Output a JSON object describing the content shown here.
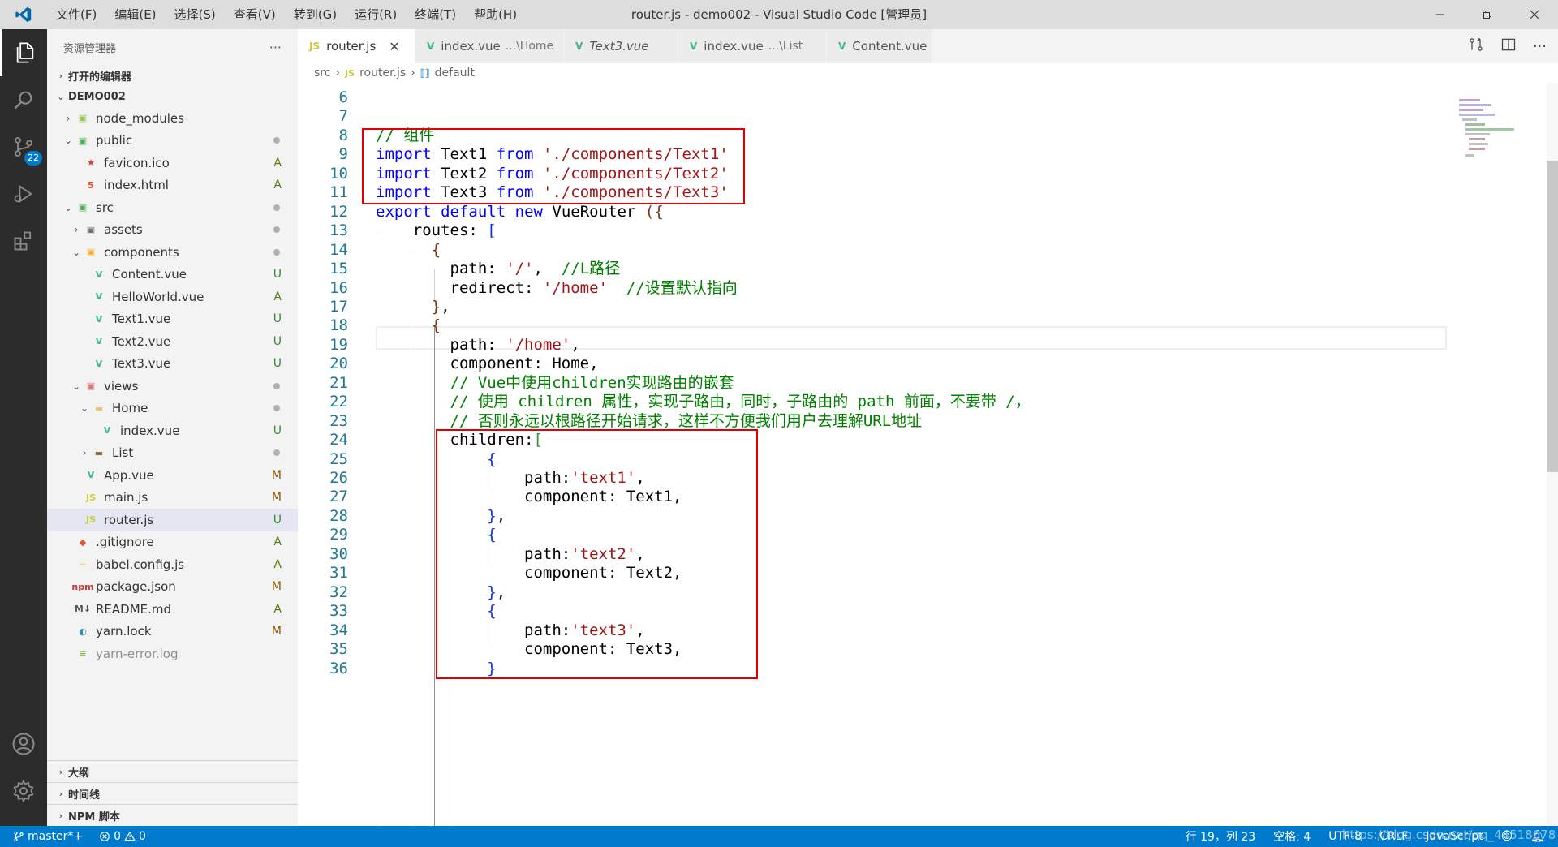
{
  "window": {
    "title": "router.js - demo002 - Visual Studio Code [管理员]",
    "menu": [
      "文件(F)",
      "编辑(E)",
      "选择(S)",
      "查看(V)",
      "转到(G)",
      "运行(R)",
      "终端(T)",
      "帮助(H)"
    ]
  },
  "activity": {
    "scm_badge": "22"
  },
  "sidebar": {
    "title": "资源管理器",
    "more": "···",
    "open_editors": "打开的编辑器",
    "project": "DEMO002",
    "tree": [
      {
        "label": "node_modules",
        "depth": 1,
        "chev": "›",
        "icon": "folder-node",
        "status": ""
      },
      {
        "label": "public",
        "depth": 1,
        "chev": "⌄",
        "icon": "folder-public",
        "status": "dot"
      },
      {
        "label": "favicon.ico",
        "depth": 2,
        "chev": "",
        "icon": "favicon",
        "status": "A"
      },
      {
        "label": "index.html",
        "depth": 2,
        "chev": "",
        "icon": "html",
        "status": "A"
      },
      {
        "label": "src",
        "depth": 1,
        "chev": "⌄",
        "icon": "folder-src",
        "status": "dot"
      },
      {
        "label": "assets",
        "depth": 2,
        "chev": "›",
        "icon": "folder-assets",
        "status": "dot"
      },
      {
        "label": "components",
        "depth": 2,
        "chev": "⌄",
        "icon": "folder-components",
        "status": "dot"
      },
      {
        "label": "Content.vue",
        "depth": 3,
        "chev": "",
        "icon": "vue",
        "status": "U"
      },
      {
        "label": "HelloWorld.vue",
        "depth": 3,
        "chev": "",
        "icon": "vue",
        "status": "A"
      },
      {
        "label": "Text1.vue",
        "depth": 3,
        "chev": "",
        "icon": "vue",
        "status": "U"
      },
      {
        "label": "Text2.vue",
        "depth": 3,
        "chev": "",
        "icon": "vue",
        "status": "U"
      },
      {
        "label": "Text3.vue",
        "depth": 3,
        "chev": "",
        "icon": "vue",
        "status": "U"
      },
      {
        "label": "views",
        "depth": 2,
        "chev": "⌄",
        "icon": "folder-views",
        "status": "dot"
      },
      {
        "label": "Home",
        "depth": 3,
        "chev": "⌄",
        "icon": "folder",
        "status": "dot"
      },
      {
        "label": "index.vue",
        "depth": 4,
        "chev": "",
        "icon": "vue",
        "status": "U"
      },
      {
        "label": "List",
        "depth": 3,
        "chev": "›",
        "icon": "folder-dark",
        "status": "dot"
      },
      {
        "label": "App.vue",
        "depth": 2,
        "chev": "",
        "icon": "vue",
        "status": "M"
      },
      {
        "label": "main.js",
        "depth": 2,
        "chev": "",
        "icon": "js",
        "status": "M"
      },
      {
        "label": "router.js",
        "depth": 2,
        "chev": "",
        "icon": "js",
        "status": "U",
        "selected": true
      },
      {
        "label": ".gitignore",
        "depth": 1,
        "chev": "",
        "icon": "git",
        "status": "A"
      },
      {
        "label": "babel.config.js",
        "depth": 1,
        "chev": "",
        "icon": "babel",
        "status": "A"
      },
      {
        "label": "package.json",
        "depth": 1,
        "chev": "",
        "icon": "npm",
        "status": "M"
      },
      {
        "label": "README.md",
        "depth": 1,
        "chev": "",
        "icon": "md",
        "status": "A"
      },
      {
        "label": "yarn.lock",
        "depth": 1,
        "chev": "",
        "icon": "yarn",
        "status": "M"
      },
      {
        "label": "yarn-error.log",
        "depth": 1,
        "chev": "",
        "icon": "log",
        "status": "",
        "muted": true
      }
    ],
    "bottom_sections": [
      "大纲",
      "时间线",
      "NPM 脚本"
    ]
  },
  "tabs": [
    {
      "label": "router.js",
      "desc": "",
      "icon": "js",
      "active": true,
      "italic": false
    },
    {
      "label": "index.vue",
      "desc": "...\\Home",
      "icon": "vue",
      "active": false,
      "italic": false
    },
    {
      "label": "Text3.vue",
      "desc": "",
      "icon": "vue",
      "active": false,
      "italic": true
    },
    {
      "label": "index.vue",
      "desc": "...\\List",
      "icon": "vue",
      "active": false,
      "italic": false
    },
    {
      "label": "Content.vue",
      "desc": "",
      "icon": "vue",
      "active": false,
      "italic": false
    }
  ],
  "breadcrumb": [
    "src",
    "router.js",
    "default"
  ],
  "code": [
    {
      "n": "6",
      "t": []
    },
    {
      "n": "7",
      "t": []
    },
    {
      "n": "8",
      "t": [
        [
          "c",
          "// 组件"
        ]
      ]
    },
    {
      "n": "9",
      "t": [
        [
          "k",
          "import"
        ],
        [
          "p",
          " Text1 "
        ],
        [
          "k",
          "from"
        ],
        [
          "p",
          " "
        ],
        [
          "s",
          "'./components/Text1'"
        ]
      ]
    },
    {
      "n": "10",
      "t": [
        [
          "k",
          "import"
        ],
        [
          "p",
          " Text2 "
        ],
        [
          "k",
          "from"
        ],
        [
          "p",
          " "
        ],
        [
          "s",
          "'./components/Text2'"
        ]
      ]
    },
    {
      "n": "11",
      "t": [
        [
          "k",
          "import"
        ],
        [
          "p",
          " Text3 "
        ],
        [
          "k",
          "from"
        ],
        [
          "p",
          " "
        ],
        [
          "s",
          "'./components/Text3'"
        ]
      ]
    },
    {
      "n": "12",
      "t": [
        [
          "k",
          "export"
        ],
        [
          "p",
          " "
        ],
        [
          "k",
          "default"
        ],
        [
          "p",
          " "
        ],
        [
          "k",
          "new"
        ],
        [
          "p",
          " VueRouter "
        ],
        [
          "b3",
          "({"
        ]
      ]
    },
    {
      "n": "13",
      "t": [
        [
          "p",
          "    routes: "
        ],
        [
          "b1",
          "["
        ]
      ]
    },
    {
      "n": "14",
      "t": [
        [
          "p",
          "      "
        ],
        [
          "b3",
          "{"
        ]
      ]
    },
    {
      "n": "15",
      "t": [
        [
          "p",
          "        path: "
        ],
        [
          "s",
          "'/'"
        ],
        [
          "p",
          ",  "
        ],
        [
          "c",
          "//L路径"
        ]
      ]
    },
    {
      "n": "16",
      "t": [
        [
          "p",
          "        redirect: "
        ],
        [
          "s",
          "'/home'"
        ],
        [
          "p",
          "  "
        ],
        [
          "c",
          "//设置默认指向"
        ]
      ]
    },
    {
      "n": "17",
      "t": [
        [
          "p",
          "      "
        ],
        [
          "b3",
          "}"
        ],
        [
          "p",
          ","
        ]
      ]
    },
    {
      "n": "18",
      "t": [
        [
          "p",
          "      "
        ],
        [
          "b3",
          "{"
        ]
      ]
    },
    {
      "n": "19",
      "t": [
        [
          "p",
          "        path: "
        ],
        [
          "s",
          "'/home'"
        ],
        [
          "p",
          ","
        ]
      ]
    },
    {
      "n": "20",
      "t": [
        [
          "p",
          "        component: Home,"
        ]
      ]
    },
    {
      "n": "21",
      "t": [
        [
          "p",
          "        "
        ],
        [
          "c",
          "// Vue中使用children实现路由的嵌套"
        ]
      ]
    },
    {
      "n": "22",
      "t": [
        [
          "p",
          "        "
        ],
        [
          "c",
          "// 使用 children 属性，实现子路由，同时，子路由的 path 前面，不要带 /，"
        ]
      ]
    },
    {
      "n": "23",
      "t": [
        [
          "p",
          "        "
        ],
        [
          "c",
          "// 否则永远以根路径开始请求，这样不方便我们用户去理解URL地址"
        ]
      ]
    },
    {
      "n": "24",
      "t": [
        [
          "p",
          "        children:"
        ],
        [
          "b2",
          "["
        ]
      ]
    },
    {
      "n": "25",
      "t": [
        [
          "p",
          "            "
        ],
        [
          "b1",
          "{"
        ]
      ]
    },
    {
      "n": "26",
      "t": [
        [
          "p",
          "                path:"
        ],
        [
          "s",
          "'text1'"
        ],
        [
          "p",
          ","
        ]
      ]
    },
    {
      "n": "27",
      "t": [
        [
          "p",
          "                component: Text1,"
        ]
      ]
    },
    {
      "n": "28",
      "t": [
        [
          "p",
          "            "
        ],
        [
          "b1",
          "}"
        ],
        [
          "p",
          ","
        ]
      ]
    },
    {
      "n": "29",
      "t": [
        [
          "p",
          "            "
        ],
        [
          "b1",
          "{"
        ]
      ]
    },
    {
      "n": "30",
      "t": [
        [
          "p",
          "                path:"
        ],
        [
          "s",
          "'text2'"
        ],
        [
          "p",
          ","
        ]
      ]
    },
    {
      "n": "31",
      "t": [
        [
          "p",
          "                component: Text2,"
        ]
      ]
    },
    {
      "n": "32",
      "t": [
        [
          "p",
          "            "
        ],
        [
          "b1",
          "}"
        ],
        [
          "p",
          ","
        ]
      ]
    },
    {
      "n": "33",
      "t": [
        [
          "p",
          "            "
        ],
        [
          "b1",
          "{"
        ]
      ]
    },
    {
      "n": "34",
      "t": [
        [
          "p",
          "                path:"
        ],
        [
          "s",
          "'text3'"
        ],
        [
          "p",
          ","
        ]
      ]
    },
    {
      "n": "35",
      "t": [
        [
          "p",
          "                component: Text3,"
        ]
      ]
    },
    {
      "n": "36",
      "t": [
        [
          "p",
          "            "
        ],
        [
          "b1",
          "}"
        ]
      ]
    }
  ],
  "statusbar": {
    "branch": "master*+",
    "errors": "0",
    "warnings": "0",
    "position": "行 19，列 23",
    "spaces": "空格: 4",
    "encoding": "UTF-8",
    "eol": "CRLF",
    "language": "JavaScript",
    "watermark": "https://blog.csdn.net/qq_44518678"
  },
  "colors": {
    "accent": "#007acc",
    "highlight_box": "#e60000",
    "keyword": "#0000ff",
    "string": "#a31515",
    "comment": "#008000"
  }
}
